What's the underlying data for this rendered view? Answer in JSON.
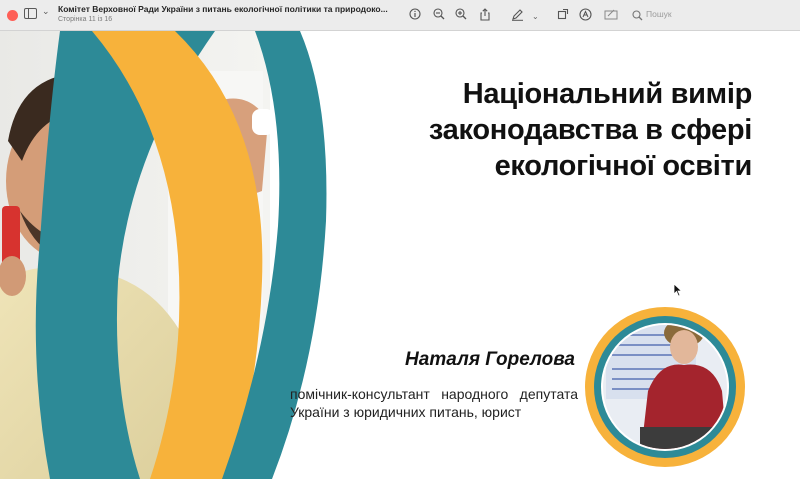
{
  "window": {
    "title": "Комітет Верховної Ради України з питань екологічної політики та природоко...",
    "page_indicator": "Сторінка 11 із 16"
  },
  "toolbar": {
    "search_placeholder": "Пошук",
    "icons": [
      "sidebar-icon",
      "chevron-down-icon",
      "info-icon",
      "zoom-out-icon",
      "zoom-in-icon",
      "share-icon",
      "pen-icon",
      "chevron-down-icon",
      "rotate-icon",
      "markup-icon",
      "form-icon",
      "search-icon"
    ]
  },
  "slide": {
    "title": "Національний вимір\nзаконодавства в сфері\nекологічної освіти",
    "speaker_name": "Наталя Горелова",
    "speaker_role": "помічник-консультант народного депутата України з юридичних питань, юрист"
  },
  "colors": {
    "teal": "#2d8a97",
    "orange": "#f7b23b",
    "toolbar_bg": "#ececec"
  }
}
